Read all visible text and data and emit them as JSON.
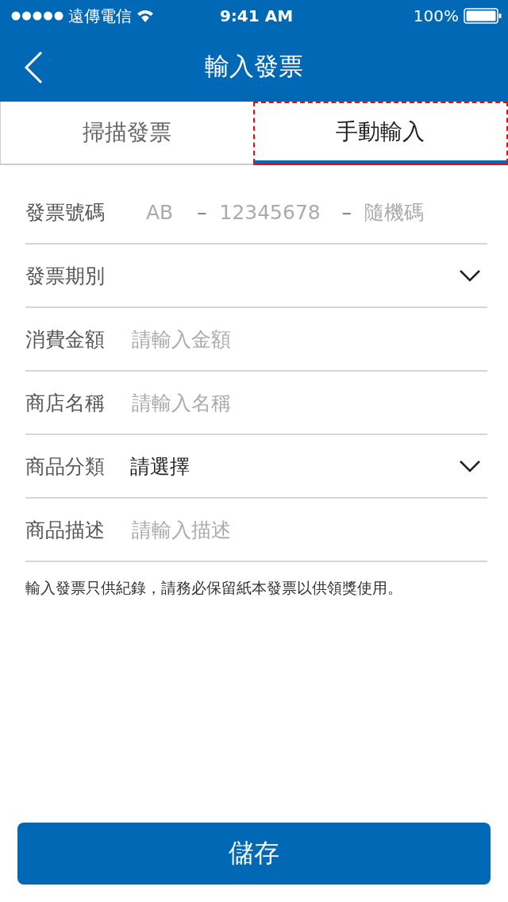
{
  "status_bar": {
    "carrier": "遠傳電信",
    "time": "9:41 AM",
    "battery": "100%"
  },
  "nav": {
    "title": "輸入發票"
  },
  "tabs": [
    {
      "label": "掃描發票",
      "selected": false
    },
    {
      "label": "手動輸入",
      "selected": true
    }
  ],
  "fields": [
    {
      "kind": "code",
      "label": "發票號碼",
      "inputs": [
        {
          "placeholder": "AB"
        },
        {
          "placeholder": "12345678"
        },
        {
          "placeholder": "隨機碼"
        }
      ],
      "separators": [
        "–",
        "–"
      ]
    },
    {
      "kind": "select",
      "label": "發票期別"
    },
    {
      "kind": "text",
      "label": "消費金額",
      "placeholder": "請輸入金額"
    },
    {
      "kind": "text",
      "label": "商店名稱",
      "placeholder": "請輸入名稱"
    },
    {
      "kind": "select",
      "label": "商品分類",
      "value": "請選擇"
    },
    {
      "kind": "text",
      "label": "商品描述",
      "placeholder": "請輸入描述"
    }
  ],
  "note": "輸入發票只供紀錄，請務必保留紙本發票以供領獎使用。",
  "save_button": "儲存"
}
